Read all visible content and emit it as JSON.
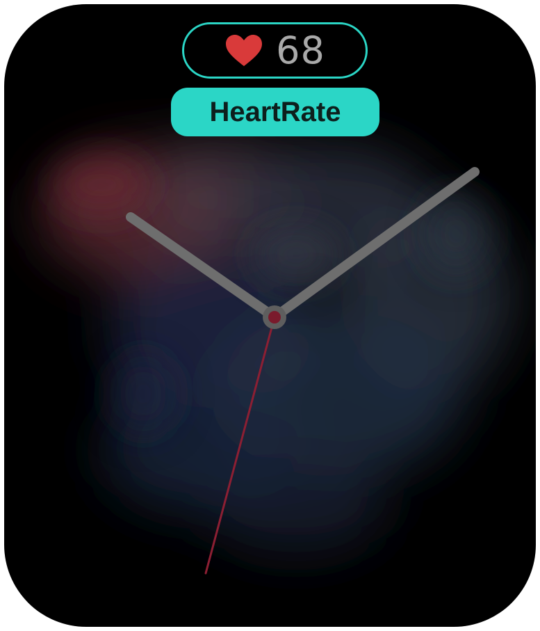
{
  "complication": {
    "icon": "heart-icon",
    "value": "68",
    "label": "HeartRate"
  },
  "colors": {
    "accent": "#2bd6c6",
    "heart": "#d93a3a",
    "hands": "#6e6e6e",
    "second_hand": "#8c1f33",
    "background": "#000000"
  }
}
